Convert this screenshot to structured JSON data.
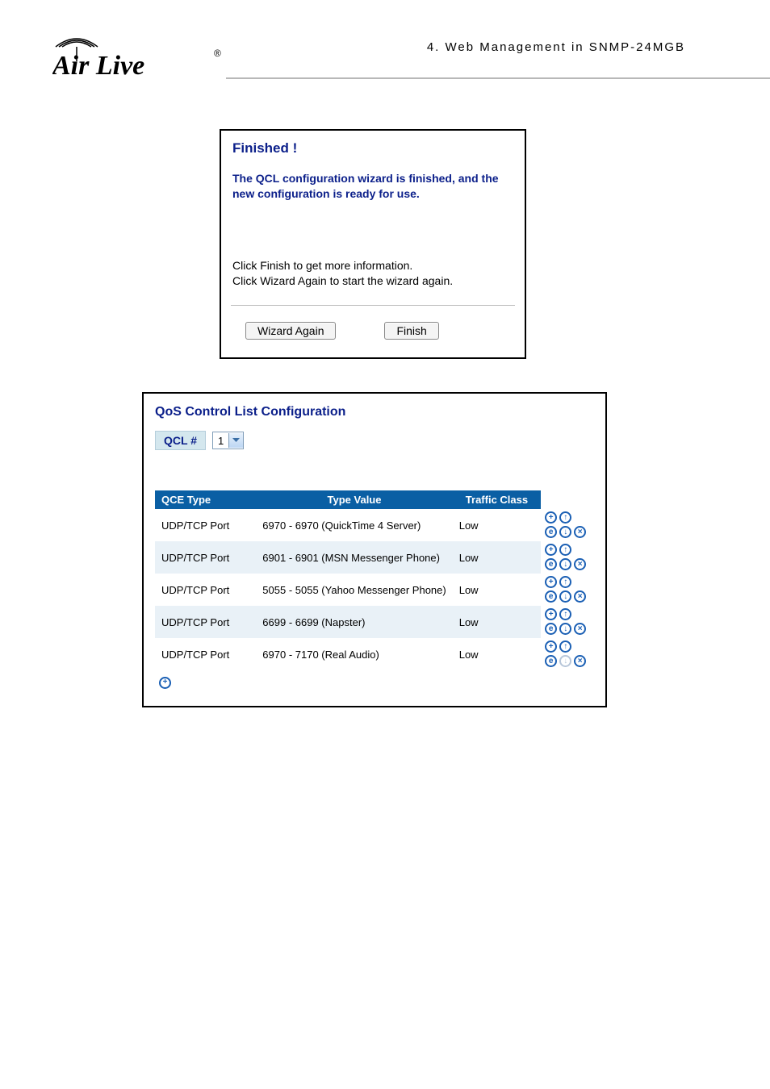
{
  "header": {
    "breadcrumb": "4.   Web  Management  in  SNMP-24MGB",
    "brand": "Air Live"
  },
  "wizard": {
    "title": "Finished !",
    "message": "The QCL configuration wizard is finished, and the new configuration is ready for use.",
    "instruction1": "Click Finish to get more information.",
    "instruction2": "Click Wizard Again to start the wizard again.",
    "btn_again": "Wizard Again",
    "btn_finish": "Finish"
  },
  "qcl": {
    "title": "QoS Control List Configuration",
    "filter_label": "QCL #",
    "filter_value": "1",
    "col_type": "QCE Type",
    "col_value": "Type Value",
    "col_class": "Traffic Class",
    "rows": [
      {
        "type": "UDP/TCP Port",
        "value": "6970 - 6970 (QuickTime 4 Server)",
        "tclass": "Low",
        "up_disabled": false,
        "down_disabled": false
      },
      {
        "type": "UDP/TCP Port",
        "value": "6901 - 6901 (MSN Messenger Phone)",
        "tclass": "Low",
        "up_disabled": false,
        "down_disabled": false
      },
      {
        "type": "UDP/TCP Port",
        "value": "5055 - 5055 (Yahoo Messenger Phone)",
        "tclass": "Low",
        "up_disabled": false,
        "down_disabled": false
      },
      {
        "type": "UDP/TCP Port",
        "value": "6699 - 6699 (Napster)",
        "tclass": "Low",
        "up_disabled": false,
        "down_disabled": false
      },
      {
        "type": "UDP/TCP Port",
        "value": "6970 - 7170 (Real Audio)",
        "tclass": "Low",
        "up_disabled": false,
        "down_disabled": true
      }
    ]
  }
}
